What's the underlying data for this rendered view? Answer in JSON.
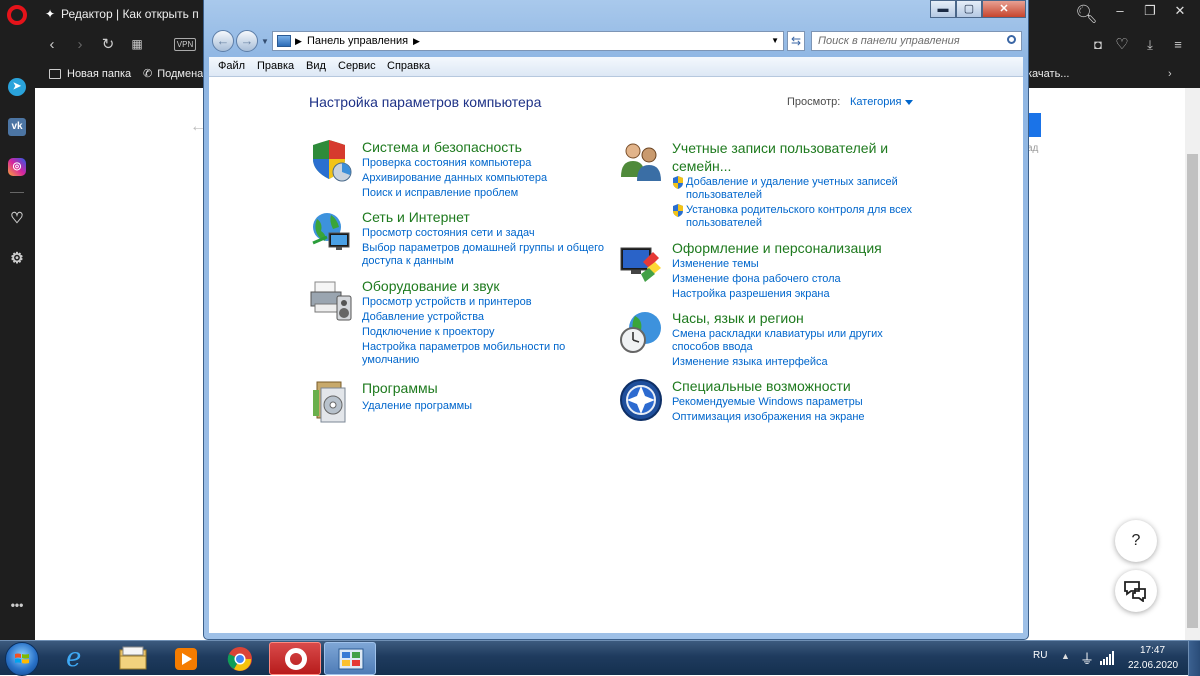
{
  "browser": {
    "tab_title": "Редактор | Как открыть па",
    "bookmarks": [
      {
        "label": "Новая папка"
      },
      {
        "label": "Подмена"
      }
    ],
    "bookmarks_tail": "качать...",
    "vpn_label": "VPN",
    "bg_side_text": "ад",
    "help_button": "?"
  },
  "window": {
    "controls": {
      "minimize": "▬",
      "maximize": "▢",
      "close": "✕"
    }
  },
  "nav": {
    "address": "Панель управления",
    "search_placeholder": "Поиск в панели управления"
  },
  "menu": {
    "file": "Файл",
    "edit": "Правка",
    "view": "Вид",
    "service": "Сервис",
    "help": "Справка"
  },
  "content": {
    "heading": "Настройка параметров компьютера",
    "view_label": "Просмотр:",
    "view_value": "Категория",
    "left": [
      {
        "title": "Система и безопасность",
        "icon": "shield-chart-icon",
        "links": [
          "Проверка состояния компьютера",
          "Архивирование данных компьютера",
          "Поиск и исправление проблем"
        ]
      },
      {
        "title": "Сеть и Интернет",
        "icon": "network-globe-icon",
        "links": [
          "Просмотр состояния сети и задач",
          "Выбор параметров домашней группы и общего доступа к данным"
        ]
      },
      {
        "title": "Оборудование и звук",
        "icon": "printer-speaker-icon",
        "links": [
          "Просмотр устройств и принтеров",
          "Добавление устройства",
          "Подключение к проектору",
          "Настройка параметров мобильности по умолчанию"
        ]
      },
      {
        "title": "Программы",
        "icon": "programs-icon",
        "links": [
          "Удаление программы"
        ]
      }
    ],
    "right": [
      {
        "title": "Учетные записи пользователей и семейн...",
        "icon": "users-icon",
        "links": [
          "Добавление и удаление учетных записей пользователей",
          "Установка родительского контроля для всех пользователей"
        ]
      },
      {
        "title": "Оформление и персонализация",
        "icon": "appearance-icon",
        "links": [
          "Изменение темы",
          "Изменение фона рабочего стола",
          "Настройка разрешения экрана"
        ]
      },
      {
        "title": "Часы, язык и регион",
        "icon": "clock-globe-icon",
        "links": [
          "Смена раскладки клавиатуры или других способов ввода",
          "Изменение языка интерфейса"
        ]
      },
      {
        "title": "Специальные возможности",
        "icon": "accessibility-icon",
        "links": [
          "Рекомендуемые Windows параметры",
          "Оптимизация изображения на экране"
        ]
      }
    ]
  },
  "taskbar": {
    "lang": "RU",
    "time": "17:47",
    "date": "22.06.2020"
  }
}
